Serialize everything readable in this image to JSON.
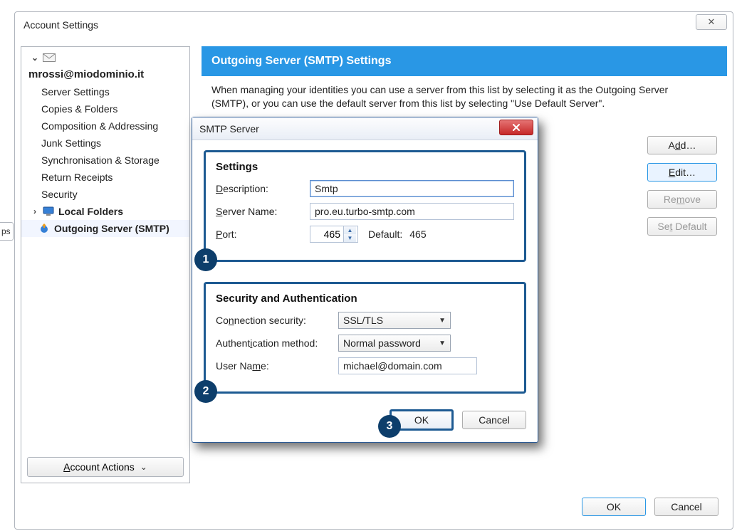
{
  "window": {
    "title": "Account Settings",
    "close_glyph": "✕"
  },
  "tree": {
    "account_email": "mrossi@miodominio.it",
    "items": [
      "Server Settings",
      "Copies & Folders",
      "Composition & Addressing",
      "Junk Settings",
      "Synchronisation & Storage",
      "Return Receipts",
      "Security"
    ],
    "local_folders": "Local Folders",
    "outgoing": "Outgoing Server (SMTP)",
    "account_actions": "Account Actions"
  },
  "panel": {
    "header": "Outgoing Server (SMTP) Settings",
    "desc": "When managing your identities you can use a server from this list by selecting it as the Outgoing Server (SMTP), or you can use the default server from this list by selecting \"Use Default Server\"."
  },
  "side_buttons": {
    "add": "Add…",
    "edit": "Edit…",
    "remove": "Remove",
    "set_default": "Set Default"
  },
  "footer": {
    "ok": "OK",
    "cancel": "Cancel"
  },
  "left_tab": "ps",
  "dialog": {
    "title": "SMTP Server",
    "group1": {
      "title": "Settings",
      "description_label": "Description:",
      "description_value": "Smtp",
      "server_label": "Server Name:",
      "server_value": "pro.eu.turbo-smtp.com",
      "port_label": "Port:",
      "port_value": "465",
      "default_label": "Default:",
      "default_value": "465",
      "badge": "1"
    },
    "group2": {
      "title": "Security and Authentication",
      "conn_label": "Connection security:",
      "conn_value": "SSL/TLS",
      "auth_label": "Authentication method:",
      "auth_value": "Normal password",
      "user_label": "User Name:",
      "user_value": "michael@domain.com",
      "badge": "2"
    },
    "buttons": {
      "ok": "OK",
      "cancel": "Cancel",
      "badge": "3"
    }
  }
}
